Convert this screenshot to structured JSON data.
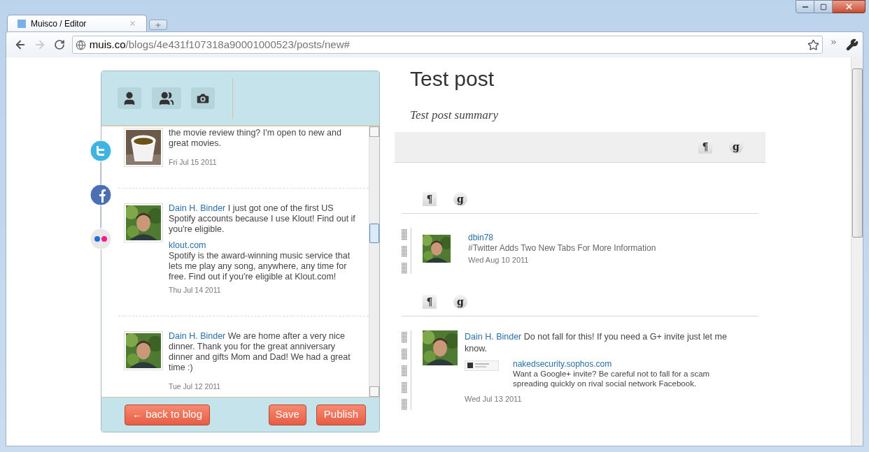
{
  "browser": {
    "tab_title": "Muisco / Editor",
    "address": {
      "host": "muis.co",
      "path": "/blogs/4e431f107318a90001000523/posts/new#"
    }
  },
  "editor": {
    "feed": [
      {
        "kind": "cup",
        "text": "the movie review thing? I'm open to new and great movies.",
        "date": "Fri Jul 15 2011"
      },
      {
        "kind": "person",
        "author": "Dain H. Binder",
        "text": "I just got one of the first US Spotify accounts because I use Klout! Find out if you're eligible.",
        "link": "klout.com",
        "description": "Spotify is the award-winning music service that lets me play any song, anywhere, any time for free.  Find out if you're eligible at Klout.com!",
        "date": "Thu Jul 14 2011"
      },
      {
        "kind": "person",
        "author": "Dain H. Binder",
        "text": "We are home after a very nice dinner. Thank you for the great anniversary dinner and gifts Mom and Dad! We had a great time :)",
        "date": "Tue Jul 12 2011"
      }
    ],
    "buttons": {
      "back": "← back to blog",
      "save": "Save",
      "publish": "Publish"
    }
  },
  "post": {
    "title": "Test post",
    "summary": "Test post summary",
    "tools": [
      "¶",
      "g"
    ],
    "blocks": [
      {
        "kind": "tweet",
        "tools": [
          "¶",
          "g"
        ],
        "author": "dbin78",
        "text": "#Twitter Adds Two New Tabs For More Information",
        "date": "Wed Aug 10 2011"
      },
      {
        "kind": "status",
        "tools": [
          "¶",
          "g"
        ],
        "author": "Dain H. Binder",
        "text": "Do not fall for this! If you need a G+ invite just let me know.",
        "link": "nakedsecurity.sophos.com",
        "description": "Want a Google+ invite? Be careful not to fall for a scam spreading quickly on rival social network Facebook.",
        "date": "Wed Jul 13 2011"
      }
    ]
  }
}
